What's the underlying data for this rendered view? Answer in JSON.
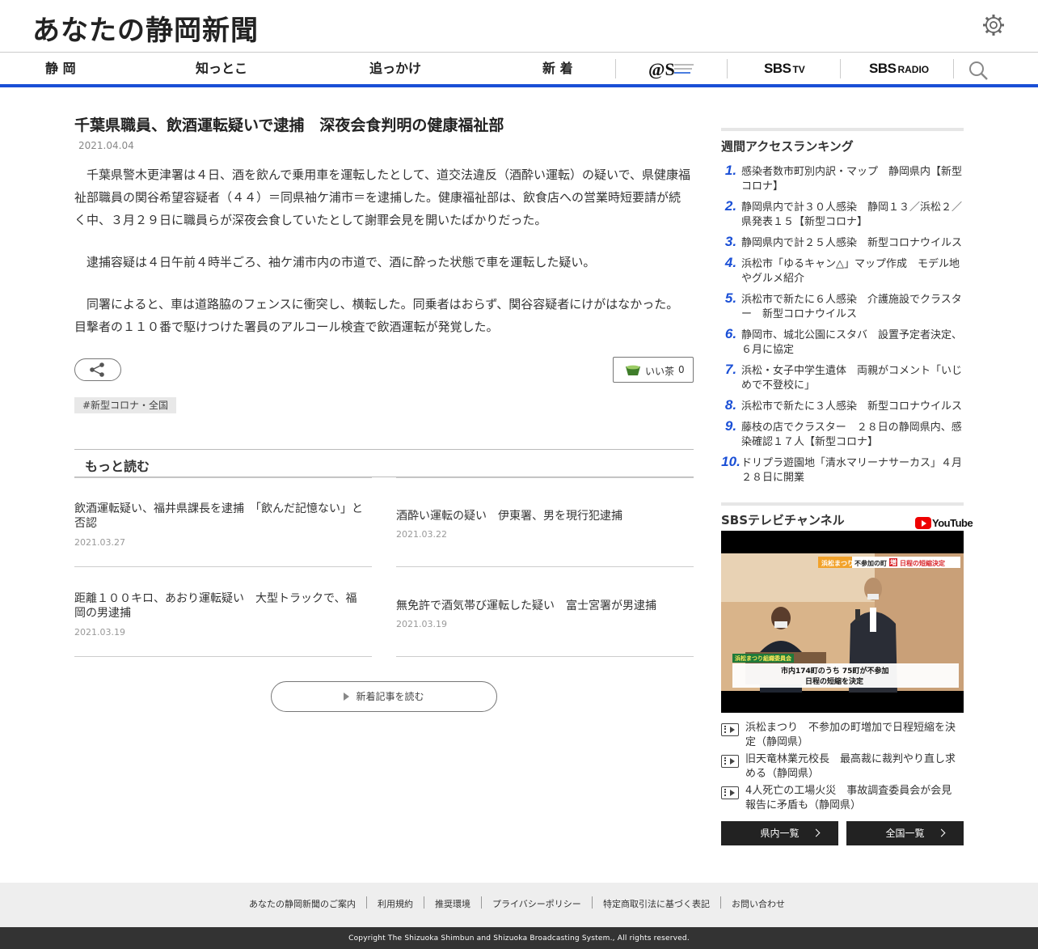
{
  "header": {
    "site_title": "あなたの静岡新聞"
  },
  "nav": {
    "items": [
      "静 岡",
      "知っとこ",
      "追っかけ",
      "新 着"
    ],
    "at_s_logo": "@S",
    "sbs_tv": {
      "main": "SBS",
      "sub": "TV"
    },
    "sbs_radio": {
      "main": "SBS",
      "sub": "RADIO"
    }
  },
  "article": {
    "title": "千葉県職員、飲酒運転疑いで逮捕　深夜会食判明の健康福祉部",
    "date": "2021.04.04",
    "paragraphs": [
      "千葉県警木更津署は４日、酒を飲んで乗用車を運転したとして、道交法違反（酒酔い運転）の疑いで、県健康福祉部職員の関谷希望容疑者（４４）＝同県袖ケ浦市＝を逮捕した。健康福祉部は、飲食店への営業時短要請が続く中、３月２９日に職員らが深夜会食していたとして謝罪会見を開いたばかりだった。",
      "逮捕容疑は４日午前４時半ごろ、袖ケ浦市内の市道で、酒に酔った状態で車を運転した疑い。",
      "同署によると、車は道路脇のフェンスに衝突し、横転した。同乗者はおらず、関谷容疑者にけがはなかった。目撃者の１１０番で駆けつけた署員のアルコール検査で飲酒運転が発覚した。"
    ],
    "good_label": "いい茶",
    "good_count": "0",
    "tag": "#新型コロナ・全国"
  },
  "more": {
    "heading": "もっと読む",
    "items": [
      {
        "title": "飲酒運転疑い、福井県課長を逮捕　「飲んだ記憶ない」と否認",
        "date": "2021.03.27"
      },
      {
        "title": "酒酔い運転の疑い　伊東署、男を現行犯逮捕",
        "date": "2021.03.22"
      },
      {
        "title": "距離１００キロ、あおり運転疑い　大型トラックで、福岡の男逮捕",
        "date": "2021.03.19"
      },
      {
        "title": "無免許で酒気帯び運転した疑い　富士宮署が男逮捕",
        "date": "2021.03.19"
      }
    ],
    "button_label": "新着記事を読む"
  },
  "ranking": {
    "title": "週間アクセスランキング",
    "items": [
      {
        "num": "1.",
        "text": "感染者数市町別内訳・マップ　静岡県内【新型コロナ】"
      },
      {
        "num": "2.",
        "text": "静岡県内で計３０人感染　静岡１３／浜松２／県発表１５【新型コロナ】"
      },
      {
        "num": "3.",
        "text": "静岡県内で計２５人感染　新型コロナウイルス"
      },
      {
        "num": "4.",
        "text": "浜松市「ゆるキャン△」マップ作成　モデル地やグルメ紹介"
      },
      {
        "num": "5.",
        "text": "浜松市で新たに６人感染　介護施設でクラスター　新型コロナウイルス"
      },
      {
        "num": "6.",
        "text": "静岡市、城北公園にスタバ　設置予定者決定、６月に協定"
      },
      {
        "num": "7.",
        "text": "浜松・女子中学生遺体　両親がコメント「いじめで不登校に」"
      },
      {
        "num": "8.",
        "text": "浜松市で新たに３人感染　新型コロナウイルス"
      },
      {
        "num": "9.",
        "text": "藤枝の店でクラスター　２８日の静岡県内、感染確認１７人【新型コロナ】"
      },
      {
        "num": "10.",
        "text": "ドリプラ遊園地「清水マリーナサーカス」４月２８日に開業"
      }
    ]
  },
  "tv": {
    "title": "SBSテレビチャンネル",
    "youtube_label": "YouTube",
    "video_captions": {
      "banner_a": "浜松まつり",
      "banner_b": "不参加の町",
      "banner_c": "増",
      "banner_d": "日程の短縮決定",
      "lower_label": "浜松まつり組織委員会",
      "lower_line1": "市内174町のうち 75町が不参加",
      "lower_line2": "日程の短縮を決定"
    },
    "videos": [
      "浜松まつり　不参加の町増加で日程短縮を決定（静岡県）",
      "旧天竜林業元校長　最高裁に裁判やり直し求める（静岡県）",
      "4人死亡の工場火災　事故調査委員会が会見　報告に矛盾も（静岡県）"
    ],
    "btn_local": "県内一覧",
    "btn_national": "全国一覧"
  },
  "footer": {
    "links": [
      "あなたの静岡新聞のご案内",
      "利用規約",
      "推奨環境",
      "プライバシーポリシー",
      "特定商取引法に基づく表記",
      "お問い合わせ"
    ],
    "copyright": "Copyright The Shizuoka Shimbun and Shizuoka Broadcasting System., All rights reserved."
  },
  "colors": {
    "accent": "#1a4fd6",
    "rank_number": "#1a4fd6",
    "button_dark": "#222222"
  },
  "icons": [
    "gear-icon",
    "search-icon",
    "share-icon",
    "tea-cup-icon",
    "video-icon",
    "chevron-right-icon",
    "youtube-icon"
  ]
}
